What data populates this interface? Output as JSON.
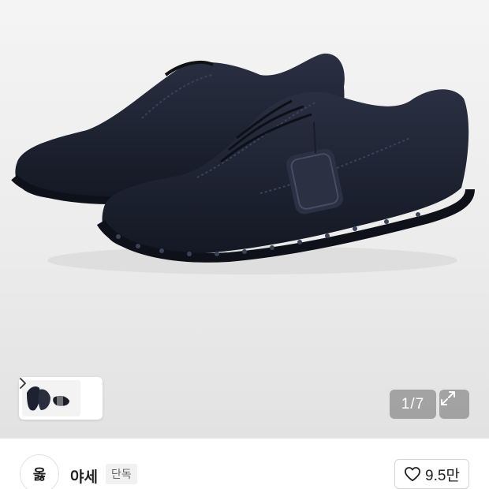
{
  "gallery": {
    "image_alt": "",
    "counter": "1/7",
    "thumbnail_arrow": "chevron-right-icon",
    "expand_icon": "expand-icon"
  },
  "seller": {
    "avatar_text": "옳",
    "name": "야세",
    "badge": "단독"
  },
  "like": {
    "icon": "heart-outline-icon",
    "count": "9.5만"
  },
  "colors": {
    "shoe": "#1c2030",
    "overlay": "#6e6e6e",
    "border": "#d6d6d6"
  }
}
